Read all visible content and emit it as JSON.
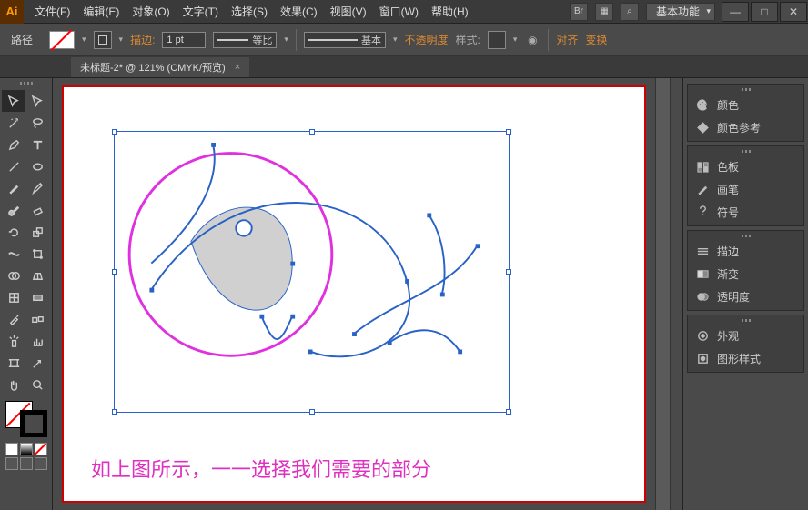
{
  "app": {
    "logo": "Ai"
  },
  "menu": [
    {
      "label": "文件(F)"
    },
    {
      "label": "编辑(E)"
    },
    {
      "label": "对象(O)"
    },
    {
      "label": "文字(T)"
    },
    {
      "label": "选择(S)"
    },
    {
      "label": "效果(C)"
    },
    {
      "label": "视图(V)"
    },
    {
      "label": "窗口(W)"
    },
    {
      "label": "帮助(H)"
    }
  ],
  "titlebar": {
    "workspace": "基本功能",
    "br_icon": "Br"
  },
  "window_controls": {
    "min": "—",
    "max": "□",
    "close": "✕"
  },
  "controlbar": {
    "mode": "路径",
    "stroke_label": "描边:",
    "stroke_value": "1 pt",
    "dash_label": "等比",
    "profile_label": "基本",
    "opacity_label": "不透明度",
    "style_label": "样式:",
    "align_label": "对齐",
    "transform_label": "变换"
  },
  "document": {
    "tab_title": "未标题-2* @ 121% (CMYK/预览)",
    "close": "×"
  },
  "canvas": {
    "caption": "如上图所示，一一选择我们需要的部分"
  },
  "panels": {
    "group1": [
      {
        "label": "颜色",
        "icon": "palette"
      },
      {
        "label": "颜色参考",
        "icon": "guide"
      }
    ],
    "group2": [
      {
        "label": "色板",
        "icon": "swatches"
      },
      {
        "label": "画笔",
        "icon": "brush"
      },
      {
        "label": "符号",
        "icon": "symbols"
      }
    ],
    "group3": [
      {
        "label": "描边",
        "icon": "stroke"
      },
      {
        "label": "渐变",
        "icon": "gradient"
      },
      {
        "label": "透明度",
        "icon": "transparency"
      }
    ],
    "group4": [
      {
        "label": "外观",
        "icon": "appearance"
      },
      {
        "label": "图形样式",
        "icon": "styles"
      }
    ]
  },
  "tools": [
    "selection",
    "direct-select",
    "wand",
    "lasso",
    "pen",
    "type",
    "line",
    "ellipse",
    "brush",
    "pencil",
    "blob",
    "eraser",
    "rotate",
    "scale",
    "width",
    "free-transform",
    "shape-builder",
    "perspective",
    "mesh",
    "gradient",
    "eyedropper",
    "blend",
    "symbol-spray",
    "graph",
    "artboard",
    "slice",
    "hand",
    "zoom"
  ]
}
